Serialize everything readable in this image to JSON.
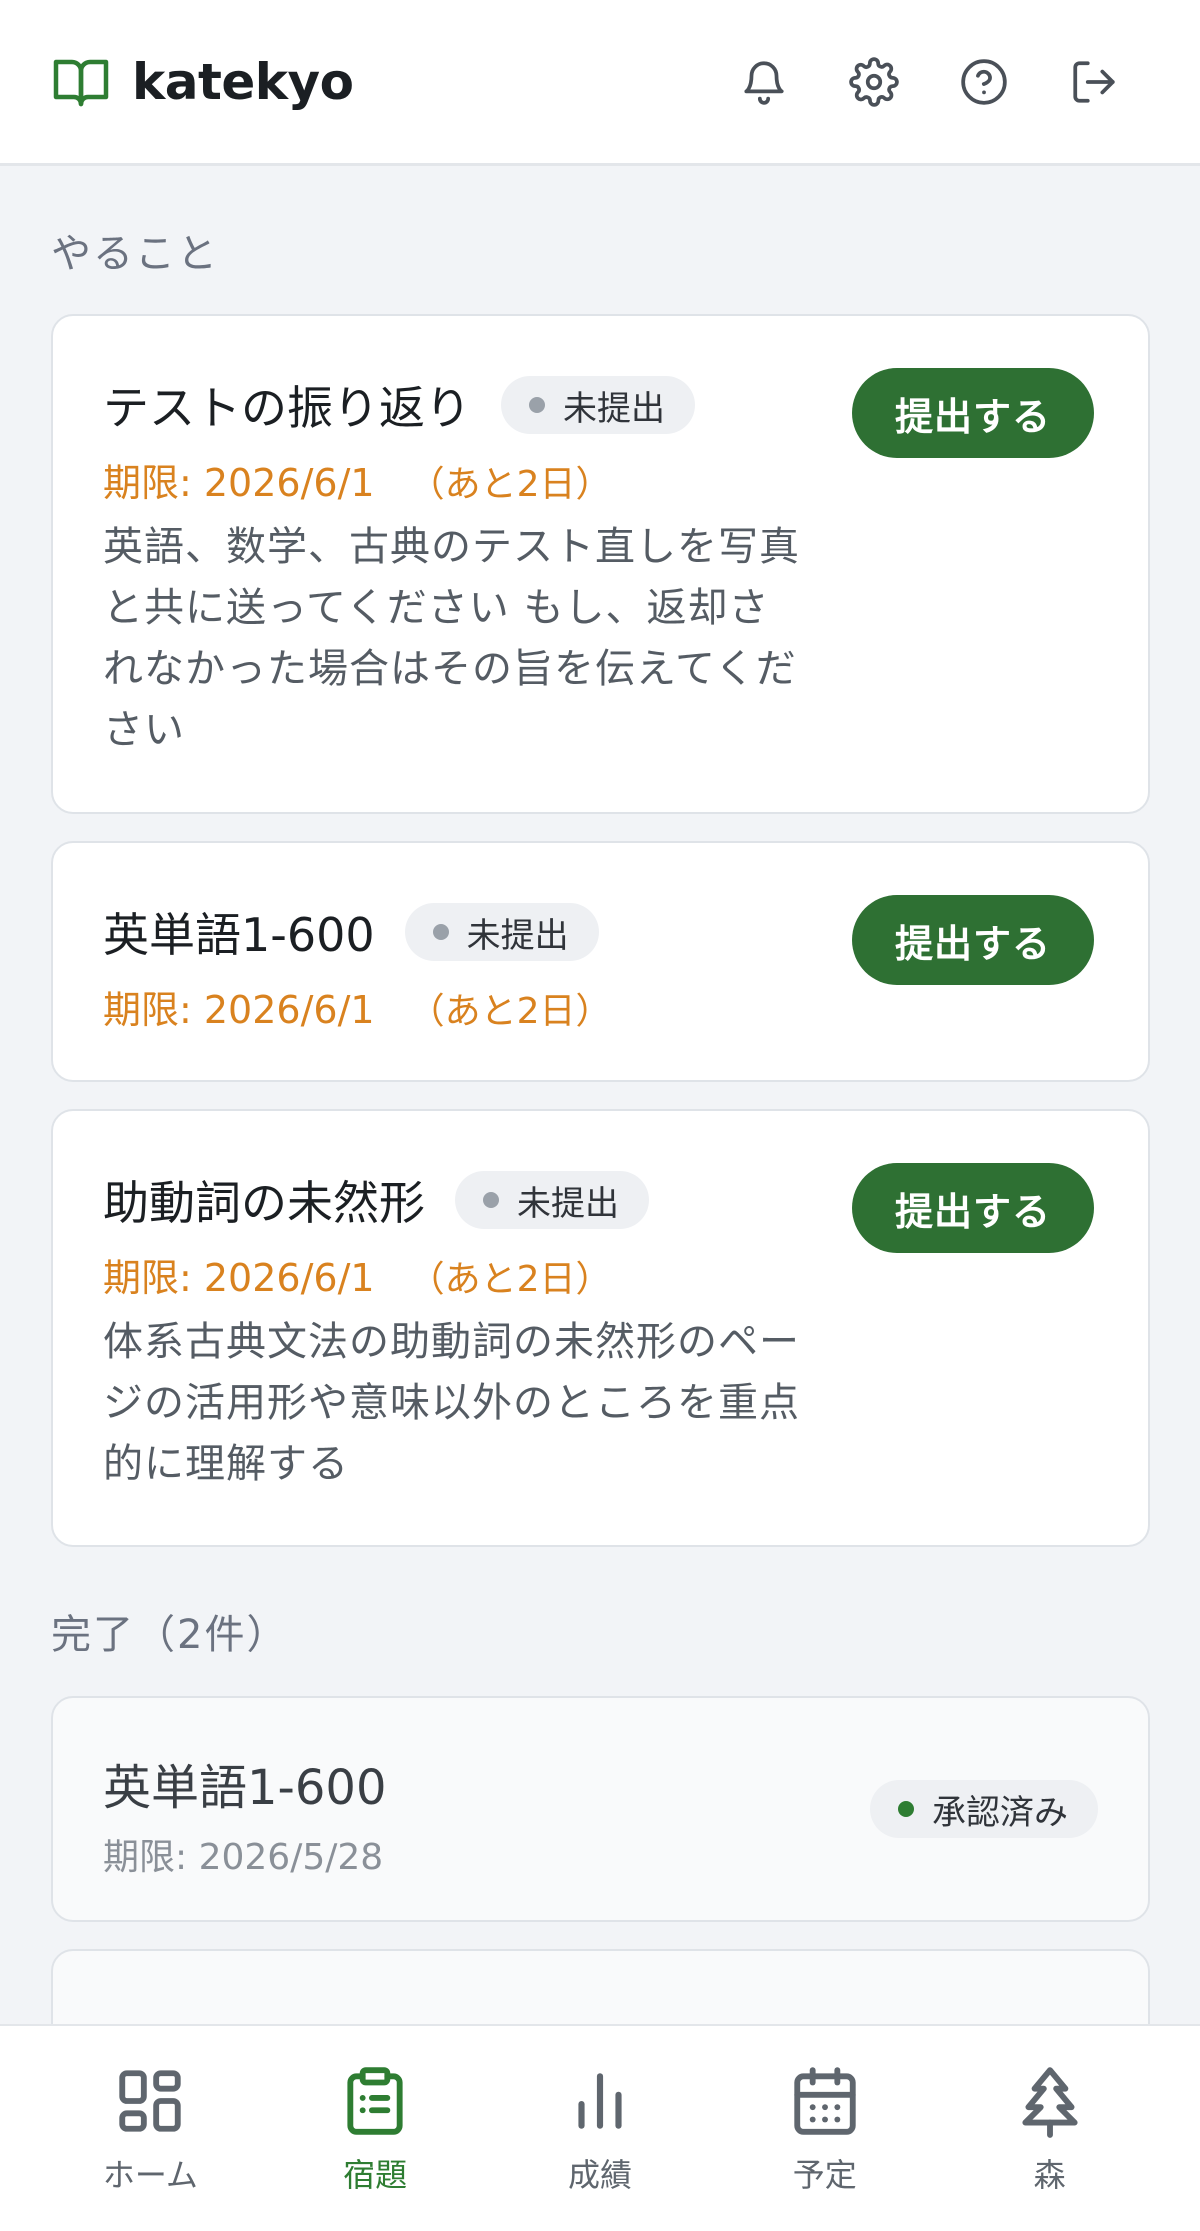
{
  "app": {
    "name": "katekyo"
  },
  "colors": {
    "primary": "#2e7033",
    "deadline": "#d9821f",
    "background": "#f2f4f7"
  },
  "header": {
    "icons": [
      "bell-icon",
      "gear-icon",
      "help-icon",
      "logout-icon"
    ]
  },
  "todo": {
    "title": "やること",
    "tasks": [
      {
        "title": "テストの振り返り",
        "status": "未提出",
        "deadline": "期限: 2026/6/1",
        "remaining": "（あと2日）",
        "description": "英語、数学、古典のテスト直しを写真と共に送ってください もし、返却されなかった場合はその旨を伝えてください",
        "button": "提出する"
      },
      {
        "title": "英単語1-600",
        "status": "未提出",
        "deadline": "期限: 2026/6/1",
        "remaining": "（あと2日）",
        "description": "",
        "button": "提出する"
      },
      {
        "title": "助動詞の未然形",
        "status": "未提出",
        "deadline": "期限: 2026/6/1",
        "remaining": "（あと2日）",
        "description": "体系古典文法の助動詞の未然形のページの活用形や意味以外のところを重点的に理解する",
        "button": "提出する"
      }
    ]
  },
  "done": {
    "title": "完了（2件）",
    "tasks": [
      {
        "title": "英単語1-600",
        "deadline": "期限: 2026/5/28",
        "status": "承認済み"
      }
    ]
  },
  "nav": {
    "items": [
      {
        "label": "ホーム",
        "icon": "home-grid-icon"
      },
      {
        "label": "宿題",
        "icon": "clipboard-icon",
        "active": true
      },
      {
        "label": "成績",
        "icon": "bar-chart-icon"
      },
      {
        "label": "予定",
        "icon": "calendar-icon"
      },
      {
        "label": "森",
        "icon": "tree-icon"
      }
    ]
  }
}
